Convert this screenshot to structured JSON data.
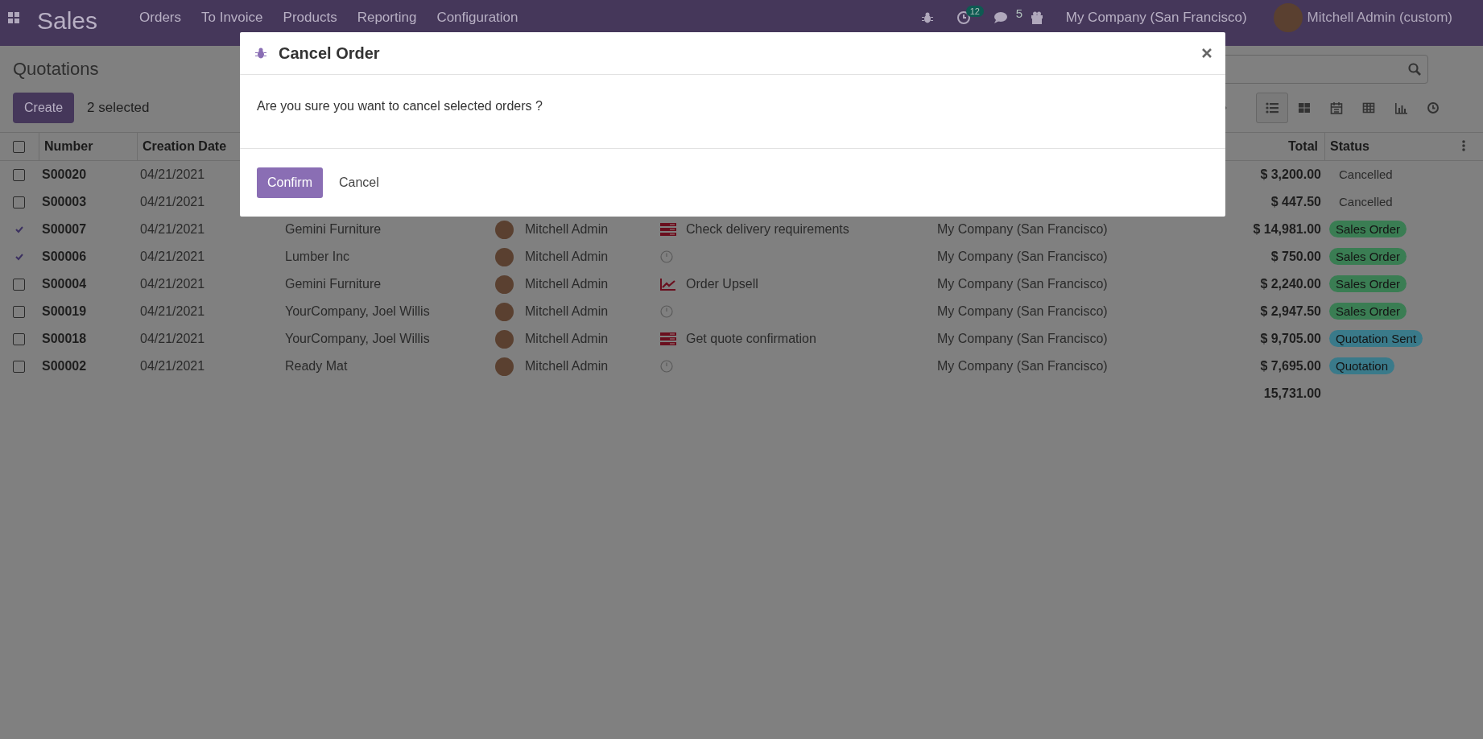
{
  "navbar": {
    "app_title": "Sales",
    "menu": [
      "Orders",
      "To Invoice",
      "Products",
      "Reporting",
      "Configuration"
    ],
    "activity_count": "12",
    "message_count": "5",
    "company": "My Company (San Francisco)",
    "user": "Mitchell Admin (custom)"
  },
  "control_panel": {
    "title": "Quotations",
    "create_button": "Create",
    "selection_count": "2 selected",
    "views": [
      {
        "kind": "list",
        "selected": true
      },
      {
        "kind": "kanban",
        "selected": false
      },
      {
        "kind": "calendar",
        "selected": false
      },
      {
        "kind": "pivot",
        "selected": false
      },
      {
        "kind": "graph",
        "selected": false
      },
      {
        "kind": "activity",
        "selected": false
      }
    ]
  },
  "table": {
    "all_selected": false,
    "columns": [
      "Number",
      "Creation Date",
      "Total",
      "Status"
    ],
    "rows": [
      {
        "selected": false,
        "number": "S00020",
        "date": "04/21/2021",
        "total": "$ 3,200.00",
        "status": {
          "label": "Cancelled",
          "kind": "plain"
        }
      },
      {
        "selected": false,
        "number": "S00003",
        "date": "04/21/2021",
        "total": "$ 447.50",
        "status": {
          "label": "Cancelled",
          "kind": "plain"
        }
      },
      {
        "selected": true,
        "number": "S00007",
        "date": "04/21/2021",
        "customer": "Gemini Furniture",
        "salesperson": "Mitchell Admin",
        "activity": {
          "kind": "todo",
          "label": "Check delivery requirements"
        },
        "company": "My Company (San Francisco)",
        "total": "$ 14,981.00",
        "status": {
          "label": "Sales Order",
          "kind": "badge",
          "color": "#3a7d53"
        }
      },
      {
        "selected": true,
        "number": "S00006",
        "date": "04/21/2021",
        "customer": "Lumber Inc",
        "salesperson": "Mitchell Admin",
        "activity": {
          "kind": "none"
        },
        "company": "My Company (San Francisco)",
        "total": "$ 750.00",
        "status": {
          "label": "Sales Order",
          "kind": "badge",
          "color": "#3a7d53"
        }
      },
      {
        "selected": false,
        "number": "S00004",
        "date": "04/21/2021",
        "customer": "Gemini Furniture",
        "salesperson": "Mitchell Admin",
        "activity": {
          "kind": "upsell",
          "label": "Order Upsell"
        },
        "company": "My Company (San Francisco)",
        "total": "$ 2,240.00",
        "status": {
          "label": "Sales Order",
          "kind": "badge",
          "color": "#3a7d53"
        }
      },
      {
        "selected": false,
        "number": "S00019",
        "date": "04/21/2021",
        "customer": "YourCompany, Joel Willis",
        "salesperson": "Mitchell Admin",
        "activity": {
          "kind": "none"
        },
        "company": "My Company (San Francisco)",
        "total": "$ 2,947.50",
        "status": {
          "label": "Sales Order",
          "kind": "badge",
          "color": "#3a7d53"
        }
      },
      {
        "selected": false,
        "number": "S00018",
        "date": "04/21/2021",
        "customer": "YourCompany, Joel Willis",
        "salesperson": "Mitchell Admin",
        "activity": {
          "kind": "todo",
          "label": "Get quote confirmation"
        },
        "company": "My Company (San Francisco)",
        "total": "$ 9,705.00",
        "status": {
          "label": "Quotation Sent",
          "kind": "badge",
          "color": "#3a7a8a"
        }
      },
      {
        "selected": false,
        "number": "S00002",
        "date": "04/21/2021",
        "customer": "Ready Mat",
        "salesperson": "Mitchell Admin",
        "activity": {
          "kind": "none"
        },
        "company": "My Company (San Francisco)",
        "total": "$ 7,695.00",
        "status": {
          "label": "Quotation",
          "kind": "badge",
          "color": "#3a7a8a"
        }
      }
    ],
    "sum_total": "15,731.00"
  },
  "dialog": {
    "title": "Cancel Order",
    "message": "Are you sure you want to cancel selected orders ?",
    "buttons": [
      {
        "label": "Confirm",
        "kind": "primary"
      },
      {
        "label": "Cancel",
        "kind": "link"
      }
    ]
  }
}
